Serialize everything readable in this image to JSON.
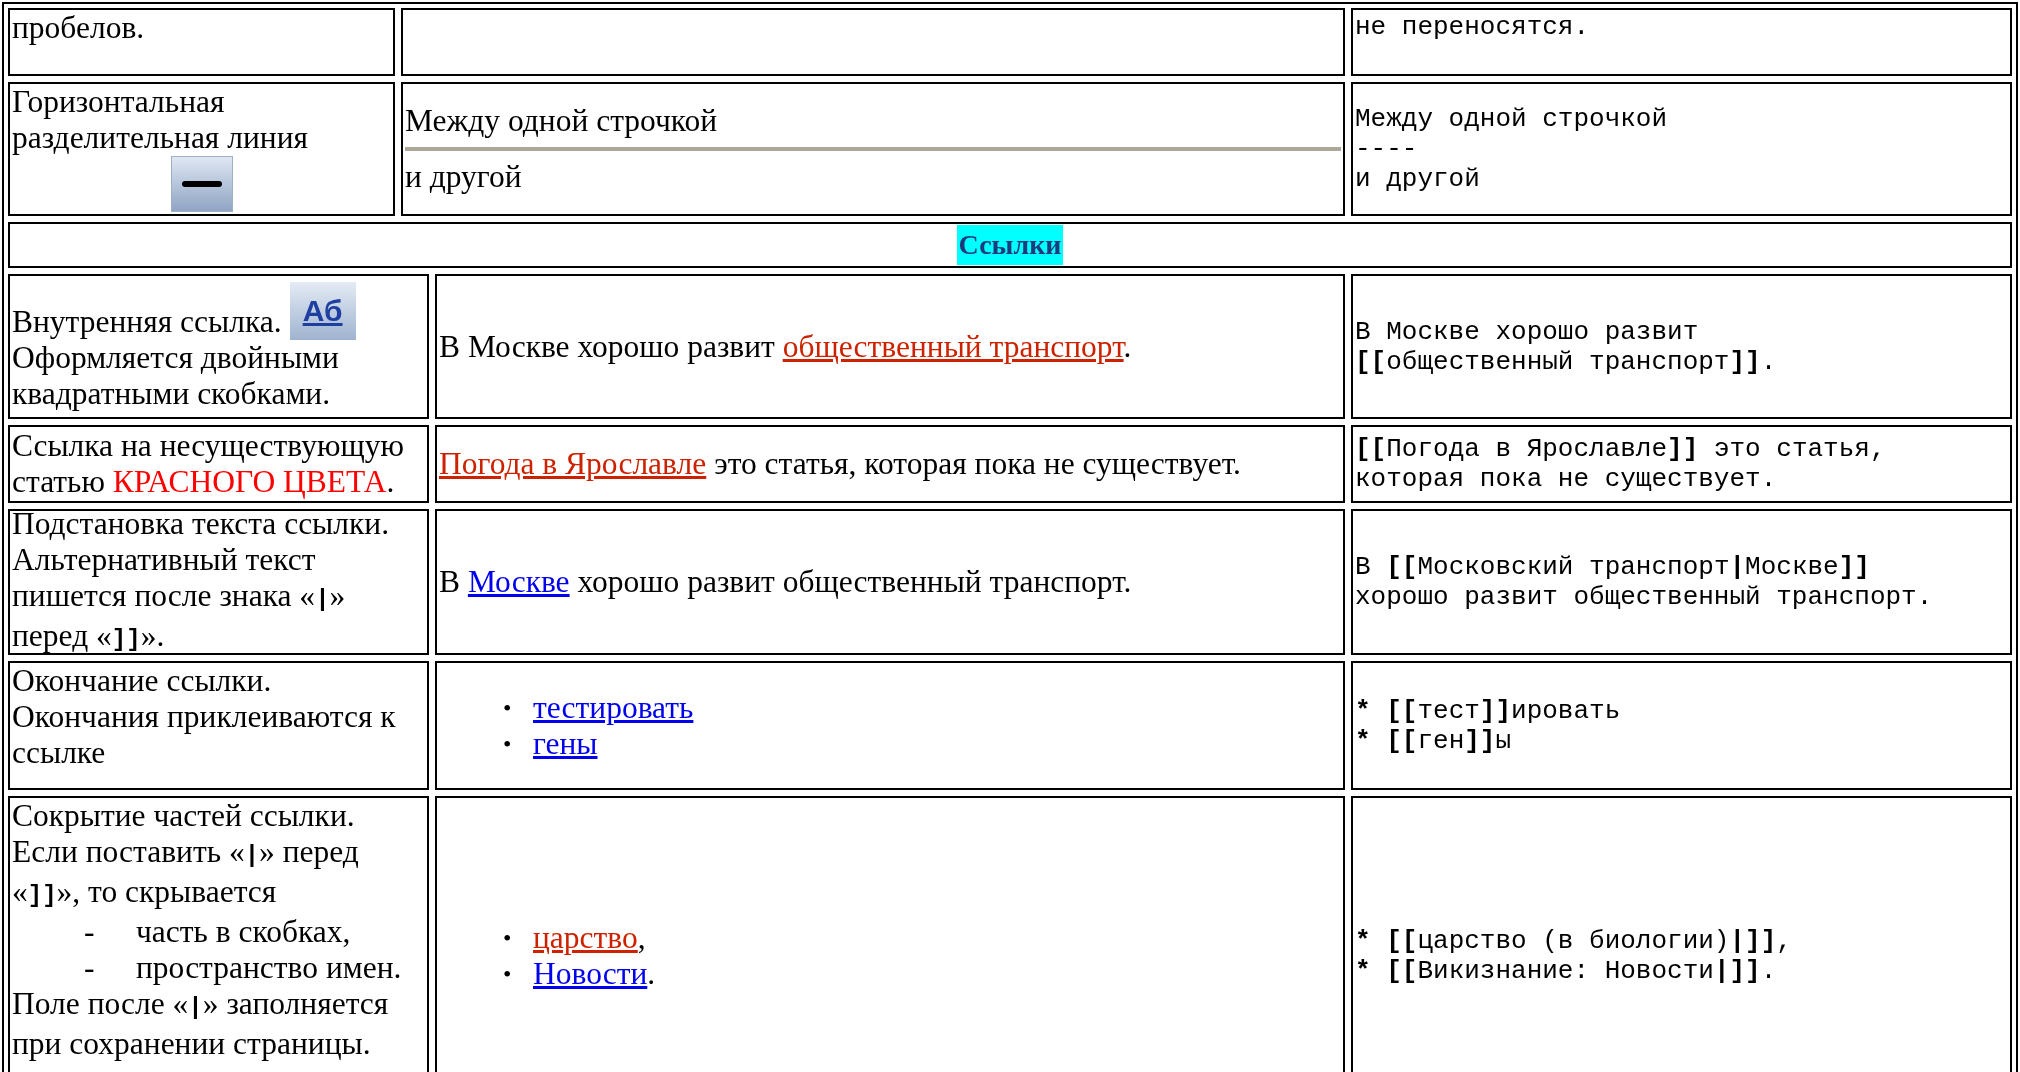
{
  "top_rows": [
    {
      "description": [
        {
          "kind": "para",
          "parts": [
            {
              "text": "пробелов.",
              "kind": "plain"
            }
          ]
        }
      ],
      "code": [
        [
          {
            "text": "не переносятся.",
            "kind": "text"
          }
        ]
      ]
    },
    {
      "description": [
        {
          "kind": "para",
          "parts": [
            {
              "text": "Горизонтальная разделительная линия",
              "kind": "plain"
            }
          ]
        },
        {
          "kind": "rule-icon"
        }
      ],
      "example": [
        {
          "kind": "para",
          "parts": [
            {
              "text": "Между одной строчкой",
              "kind": "plain"
            }
          ]
        },
        {
          "kind": "rule"
        },
        {
          "kind": "para",
          "parts": [
            {
              "text": "и другой",
              "kind": "plain"
            }
          ]
        }
      ],
      "code": [
        [
          {
            "text": "Между одной строчкой",
            "kind": "text"
          }
        ],
        [
          {
            "text": "----",
            "kind": "text"
          }
        ],
        [
          {
            "text": "и другой",
            "kind": "text"
          }
        ]
      ]
    }
  ],
  "section_header": {
    "title": "Ссылки"
  },
  "rows": [
    {
      "description": [
        {
          "kind": "para",
          "parts": [
            {
              "text": "Внутренняя ссылка.",
              "kind": "plain"
            }
          ],
          "badge": "Аб"
        },
        {
          "kind": "para",
          "parts": [
            {
              "text": "Оформляется двойными квадратными скобками.",
              "kind": "plain"
            }
          ]
        }
      ],
      "example": [
        {
          "kind": "para",
          "parts": [
            {
              "text": "В Москве хорошо развит ",
              "kind": "plain"
            },
            {
              "text": "общественный транспорт",
              "kind": "new-link"
            },
            {
              "text": ".",
              "kind": "plain"
            }
          ]
        }
      ],
      "code": [
        [
          {
            "text": "В Москве хорошо развит",
            "kind": "text"
          }
        ],
        [
          {
            "text": "[[",
            "kind": "markup"
          },
          {
            "text": "общественный транспорт",
            "kind": "text"
          },
          {
            "text": "]]",
            "kind": "markup"
          },
          {
            "text": ".",
            "kind": "text"
          }
        ]
      ]
    },
    {
      "description": [
        {
          "kind": "para",
          "parts": [
            {
              "text": "Ссылка на несуществующую статью ",
              "kind": "plain"
            },
            {
              "text": "КРАСНОГО ЦВЕТА",
              "kind": "warning"
            },
            {
              "text": ".",
              "kind": "plain"
            }
          ]
        }
      ],
      "example": [
        {
          "kind": "para",
          "parts": [
            {
              "text": "Погода в Ярославле",
              "kind": "new-link"
            },
            {
              "text": " это статья, которая пока не существует.",
              "kind": "plain"
            }
          ]
        }
      ],
      "code": [
        [
          {
            "text": "[[",
            "kind": "markup"
          },
          {
            "text": "Погода в Ярославле",
            "kind": "text"
          },
          {
            "text": "]]",
            "kind": "markup"
          },
          {
            "text": " это статья,",
            "kind": "text"
          }
        ],
        [
          {
            "text": "которая пока не существует.",
            "kind": "text"
          }
        ]
      ]
    },
    {
      "description": [
        {
          "kind": "para",
          "parts": [
            {
              "text": "Подстановка текста ссылки. Альтернативный текст пишется после знака «",
              "kind": "plain"
            },
            {
              "text": "|",
              "kind": "code"
            },
            {
              "text": "» перед «",
              "kind": "plain"
            },
            {
              "text": "]]",
              "kind": "code"
            },
            {
              "text": "».",
              "kind": "plain"
            }
          ]
        }
      ],
      "example": [
        {
          "kind": "para",
          "parts": [
            {
              "text": "В ",
              "kind": "plain"
            },
            {
              "text": "Москве",
              "kind": "link"
            },
            {
              "text": " хорошо развит общественный транспорт.",
              "kind": "plain"
            }
          ]
        }
      ],
      "code": [
        [
          {
            "text": "В ",
            "kind": "text"
          },
          {
            "text": "[[",
            "kind": "markup"
          },
          {
            "text": "Московский транспорт",
            "kind": "text"
          },
          {
            "text": "|",
            "kind": "markup"
          },
          {
            "text": "Москве",
            "kind": "text"
          },
          {
            "text": "]]",
            "kind": "markup"
          }
        ],
        [
          {
            "text": "хорошо развит общественный транспорт.",
            "kind": "text"
          }
        ]
      ]
    },
    {
      "description": [
        {
          "kind": "para",
          "parts": [
            {
              "text": "Окончание ссылки. Окончания приклеиваются к ссылке",
              "kind": "plain"
            }
          ]
        }
      ],
      "example": [
        {
          "kind": "bullet",
          "marker": "•",
          "parts": [
            {
              "text": "тестировать",
              "kind": "link"
            }
          ]
        },
        {
          "kind": "bullet",
          "marker": "•",
          "parts": [
            {
              "text": "гены",
              "kind": "link"
            }
          ]
        }
      ],
      "code": [
        [
          {
            "text": "* [[",
            "kind": "markup"
          },
          {
            "text": "тест",
            "kind": "text"
          },
          {
            "text": "]]",
            "kind": "markup"
          },
          {
            "text": "ировать",
            "kind": "text"
          }
        ],
        [
          {
            "text": "* [[",
            "kind": "markup"
          },
          {
            "text": "ген",
            "kind": "text"
          },
          {
            "text": "]]",
            "kind": "markup"
          },
          {
            "text": "ы",
            "kind": "text"
          }
        ]
      ]
    },
    {
      "description": [
        {
          "kind": "para",
          "parts": [
            {
              "text": "Сокрытие частей ссылки. Если поставить «",
              "kind": "plain"
            },
            {
              "text": "|",
              "kind": "code"
            },
            {
              "text": "» перед «",
              "kind": "plain"
            },
            {
              "text": "]]",
              "kind": "code"
            },
            {
              "text": "», то скрывается",
              "kind": "plain"
            }
          ]
        },
        {
          "kind": "dash",
          "marker": "-",
          "parts": [
            {
              "text": "часть в скобках,",
              "kind": "plain"
            }
          ]
        },
        {
          "kind": "dash",
          "marker": "-",
          "parts": [
            {
              "text": "пространство имен.",
              "kind": "plain"
            }
          ]
        },
        {
          "kind": "para",
          "parts": [
            {
              "text": "Поле после «",
              "kind": "plain"
            },
            {
              "text": "|",
              "kind": "code"
            },
            {
              "text": "» заполняется при сохранении страницы.",
              "kind": "plain"
            }
          ]
        }
      ],
      "example": [
        {
          "kind": "bullet",
          "marker": "•",
          "parts": [
            {
              "text": "царство",
              "kind": "new-link"
            },
            {
              "text": ",",
              "kind": "plain"
            }
          ]
        },
        {
          "kind": "bullet",
          "marker": "•",
          "parts": [
            {
              "text": "Новости",
              "kind": "link"
            },
            {
              "text": ".",
              "kind": "plain"
            }
          ]
        }
      ],
      "code": [
        [
          {
            "text": "* [[",
            "kind": "markup"
          },
          {
            "text": "царство (в биологии)",
            "kind": "text"
          },
          {
            "text": "|]]",
            "kind": "markup"
          },
          {
            "text": ",",
            "kind": "text"
          }
        ],
        [
          {
            "text": "* [[",
            "kind": "markup"
          },
          {
            "text": "Викизнание: Новости",
            "kind": "text"
          },
          {
            "text": "|]]",
            "kind": "markup"
          },
          {
            "text": ".",
            "kind": "text"
          }
        ]
      ]
    }
  ]
}
